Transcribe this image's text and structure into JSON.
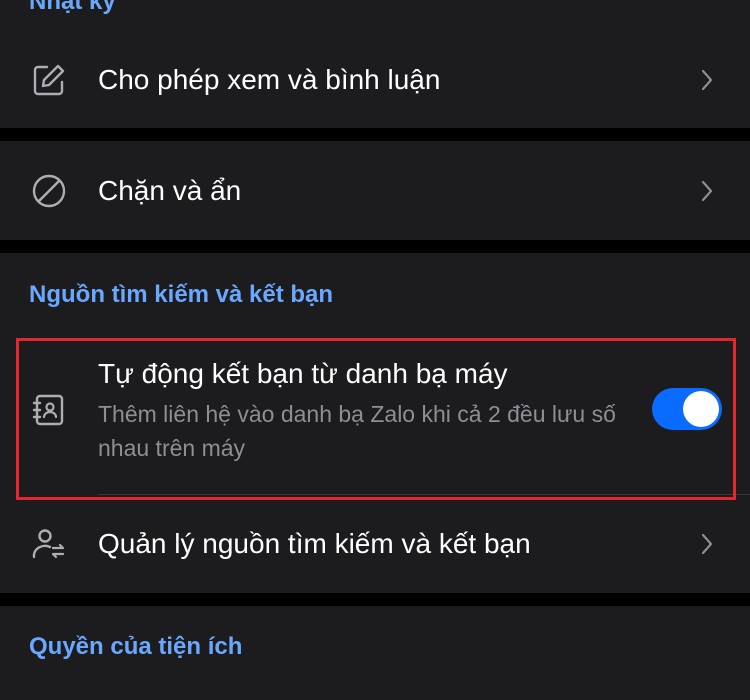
{
  "sections": {
    "top_title": "Nhật ký",
    "search_title": "Nguồn tìm kiếm và kết bạn",
    "permissions_title": "Quyền của tiện ích"
  },
  "rows": {
    "allow_view_comment": {
      "label": "Cho phép xem và bình luận",
      "icon": "edit-icon"
    },
    "block_hide": {
      "label": "Chặn và ẩn",
      "icon": "block-icon"
    },
    "auto_add_friends": {
      "label": "Tự động kết bạn từ danh bạ máy",
      "description": "Thêm liên hệ vào danh bạ Zalo khi cả 2 đều lưu số nhau trên máy",
      "icon": "contacts-book-icon",
      "toggle_on": true
    },
    "manage_sources": {
      "label": "Quản lý nguồn tìm kiếm và kết bạn",
      "icon": "user-sync-icon"
    }
  },
  "colors": {
    "background": "#000000",
    "card": "#1c1c1e",
    "section_title": "#6aa8ff",
    "toggle_on": "#0a6cff",
    "highlight": "#e3262f",
    "secondary_text": "#8e8e93"
  }
}
